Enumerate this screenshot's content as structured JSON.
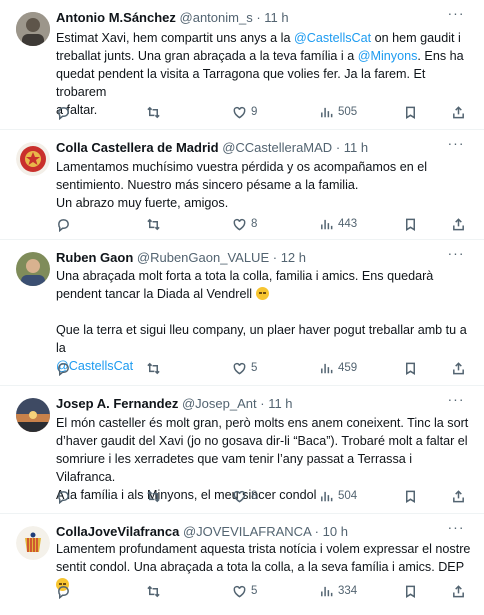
{
  "tweets": [
    {
      "name": "Antonio M.Sánchez",
      "handle": "@antonim_s",
      "time": "11 h",
      "lines": [
        [
          "Estimat Xavi, hem compartit uns anys a la ",
          "@CastellsCat",
          " on hem gaudit i"
        ],
        [
          "treballat junts.  Una gran abraçada a la teva família i a ",
          "@Minyons",
          ". Ens ha"
        ],
        [
          "quedat pendent la visita a Tarragona que volies fer. Ja la farem. Et trobarem"
        ],
        [
          "a faltar."
        ]
      ],
      "likes": "9",
      "views": "505"
    },
    {
      "name": "Colla Castellera de Madrid",
      "handle": "@CCastelleraMAD",
      "time": "11 h",
      "lines": [
        [
          "Lamentamos muchísimo vuestra pérdida y os acompañamos en el"
        ],
        [
          "sentimiento. Nuestro más sincero pésame a la familia."
        ],
        [
          "Un abrazo muy fuerte, amigos."
        ]
      ],
      "likes": "8",
      "views": "443"
    },
    {
      "name": "Ruben Gaon",
      "handle": "@RubenGaon_VALUE",
      "time": "12 h",
      "lines": [
        [
          "Una abraçada molt forta a tota la colla, familia i amics. Ens quedarà"
        ],
        [
          "pendent tancar la Diada al Vendrell "
        ],
        [
          ""
        ],
        [
          "Que la terra et sigui lleu company, un plaer haver pogut treballar amb tu a la"
        ],
        [
          "",
          "@CastellsCat",
          ""
        ]
      ],
      "likes": "5",
      "views": "459"
    },
    {
      "name": "Josep A. Fernandez",
      "handle": "@Josep_Ant",
      "time": "11 h",
      "lines": [
        [
          "El món casteller és molt gran, però molts ens anem coneixent. Tinc la sort"
        ],
        [
          "d’haver gaudit del Xavi (jo no gosava dir-li “Baca”). Trobaré molt a faltar el"
        ],
        [
          "somriure i les xerradetes que vam tenir l’any passat a Terrassa i Vilafranca."
        ],
        [
          "A la família i als Minyons, el meu sincer condol"
        ]
      ],
      "likes": "8",
      "views": "504"
    },
    {
      "name": "CollaJoveVilafranca",
      "handle": "@JOVEVILAFRANCA",
      "time": "10 h",
      "lines": [
        [
          "Lamentem profundament aquesta trista notícia i volem expressar el nostre"
        ],
        [
          "sentit condol. Una abraçada a tota la colla, a la seva família i amics. DEP "
        ]
      ],
      "likes": "5",
      "views": "334"
    }
  ],
  "icons": {
    "reply": "reply-icon",
    "retweet": "retweet-icon",
    "like": "heart-icon",
    "views": "views-chart-icon",
    "bookmark": "bookmark-icon",
    "share": "share-icon",
    "more": "more-options-icon"
  },
  "colors": {
    "mention": "#1d9bf0",
    "secondary_text": "#536471",
    "divider": "#eff3f4"
  },
  "more_label": "···",
  "separator": "·"
}
